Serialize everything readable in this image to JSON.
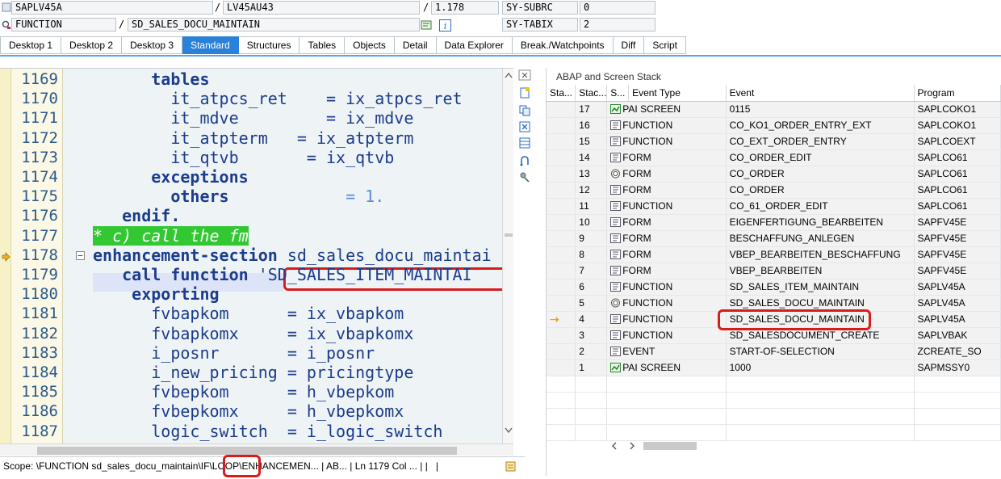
{
  "header": {
    "row1": {
      "program": "SAPLV45A",
      "include": "LV45AU43",
      "line": "1.178",
      "sy_label": "SY-SUBRC",
      "sy_value": "0"
    },
    "row2": {
      "event_type": "FUNCTION",
      "event": "SD_SALES_DOCU_MAINTAIN",
      "sy_label": "SY-TABIX",
      "sy_value": "2"
    }
  },
  "separators": {
    "slash": "/"
  },
  "tabs": [
    "Desktop 1",
    "Desktop 2",
    "Desktop 3",
    "Standard",
    "Structures",
    "Tables",
    "Objects",
    "Detail",
    "Data Explorer",
    "Break./Watchpoints",
    "Diff",
    "Script"
  ],
  "active_tab": "Standard",
  "editor": {
    "lines": [
      {
        "n": "1169",
        "text": "      tables",
        "kind": "kw"
      },
      {
        "n": "1170",
        "text": "        it_atpcs_ret    = ix_atpcs_ret",
        "kind": "plain"
      },
      {
        "n": "1171",
        "text": "        it_mdve         = ix_mdve",
        "kind": "plain"
      },
      {
        "n": "1172",
        "text": "        it_atpterm   = ix_atpterm",
        "kind": "plain"
      },
      {
        "n": "1173",
        "text": "        it_qtvb       = ix_qtvb",
        "kind": "plain"
      },
      {
        "n": "1174",
        "text": "      exceptions",
        "kind": "kw"
      },
      {
        "n": "1175",
        "text": "        others",
        "kind": "kw",
        "tail": "            = 1."
      },
      {
        "n": "1176",
        "text": "   endif.",
        "kind": "kw"
      },
      {
        "n": "1177",
        "text": "* c) call the fm",
        "kind": "comment"
      },
      {
        "n": "1178",
        "text": "enhancement-section",
        "kind": "kw",
        "tail": " sd_sales_docu_maintai"
      },
      {
        "n": "1179",
        "text": "   call function",
        "kind": "kw",
        "tail": " 'SD_SALES_ITEM_MAINTAI"
      },
      {
        "n": "1180",
        "text": "    exporting",
        "kind": "kw"
      },
      {
        "n": "1181",
        "text": "      fvbapkom      = ix_vbapkom",
        "kind": "plain"
      },
      {
        "n": "1182",
        "text": "      fvbapkomx     = ix_vbapkomx",
        "kind": "plain"
      },
      {
        "n": "1183",
        "text": "      i_posnr       = i_posnr",
        "kind": "plain"
      },
      {
        "n": "1184",
        "text": "      i_new_pricing = pricingtype",
        "kind": "plain"
      },
      {
        "n": "1185",
        "text": "      fvbepkom      = h_vbepkom",
        "kind": "plain"
      },
      {
        "n": "1186",
        "text": "      fvbepkomx     = h_vbepkomx",
        "kind": "plain"
      },
      {
        "n": "1187",
        "text": "      logic_switch  = i_logic_switch",
        "kind": "plain"
      }
    ]
  },
  "status": {
    "scope": "Scope: \\FUNCTION sd_sales_docu_maintain\\IF\\LOOP\\ENHANCEMEN...",
    "ab": "AB...",
    "pos": "Ln 1179 Col ..."
  },
  "stack": {
    "title": "ABAP and Screen Stack",
    "columns": [
      "Sta...",
      "Stac...",
      "S...",
      "Event Type",
      "Event",
      "Program"
    ],
    "rows": [
      {
        "level": "17",
        "icon": "screen-icon",
        "type": "PAI SCREEN",
        "event": "0115",
        "program": "SAPLCOKO1"
      },
      {
        "level": "16",
        "icon": "function-icon",
        "type": "FUNCTION",
        "event": "CO_KO1_ORDER_ENTRY_EXT",
        "program": "SAPLCOKO1"
      },
      {
        "level": "15",
        "icon": "function-icon",
        "type": "FUNCTION",
        "event": "CO_EXT_ORDER_ENTRY",
        "program": "SAPLCOEXT"
      },
      {
        "level": "14",
        "icon": "function-icon",
        "type": "FORM",
        "event": "CO_ORDER_EDIT",
        "program": "SAPLCO61"
      },
      {
        "level": "13",
        "icon": "circle-icon",
        "type": "FORM",
        "event": "CO_ORDER",
        "program": "SAPLCO61"
      },
      {
        "level": "12",
        "icon": "function-icon",
        "type": "FORM",
        "event": "CO_ORDER",
        "program": "SAPLCO61"
      },
      {
        "level": "11",
        "icon": "function-icon",
        "type": "FUNCTION",
        "event": "CO_61_ORDER_EDIT",
        "program": "SAPLCO61"
      },
      {
        "level": "10",
        "icon": "function-icon",
        "type": "FORM",
        "event": "EIGENFERTIGUNG_BEARBEITEN",
        "program": "SAPFV45E"
      },
      {
        "level": "9",
        "icon": "function-icon",
        "type": "FORM",
        "event": "BESCHAFFUNG_ANLEGEN",
        "program": "SAPFV45E"
      },
      {
        "level": "8",
        "icon": "function-icon",
        "type": "FORM",
        "event": "VBEP_BEARBEITEN_BESCHAFFUNG",
        "program": "SAPFV45E"
      },
      {
        "level": "7",
        "icon": "function-icon",
        "type": "FORM",
        "event": "VBEP_BEARBEITEN",
        "program": "SAPFV45E"
      },
      {
        "level": "6",
        "icon": "function-icon",
        "type": "FUNCTION",
        "event": "SD_SALES_ITEM_MAINTAIN",
        "program": "SAPLV45A"
      },
      {
        "level": "5",
        "icon": "circle-icon",
        "type": "FUNCTION",
        "event": "SD_SALES_DOCU_MAINTAIN",
        "program": "SAPLV45A"
      },
      {
        "level": "4",
        "icon": "function-icon",
        "type": "FUNCTION",
        "event": "SD_SALES_DOCU_MAINTAIN",
        "program": "SAPLV45A",
        "current": true
      },
      {
        "level": "3",
        "icon": "function-icon",
        "type": "FUNCTION",
        "event": "SD_SALESDOCUMENT_CREATE",
        "program": "SAPLVBAK"
      },
      {
        "level": "2",
        "icon": "function-icon",
        "type": "EVENT",
        "event": "START-OF-SELECTION",
        "program": "ZCREATE_SO"
      },
      {
        "level": "1",
        "icon": "screen-icon",
        "type": "PAI SCREEN",
        "event": "1000",
        "program": "SAPMSSY0"
      }
    ]
  },
  "colors": {
    "active_tab": "#2a82d8",
    "highlight_box": "#d81c1c",
    "comment_bg": "#32c832",
    "code": "#1c3c8c",
    "current_arrow": "#f0a020"
  }
}
